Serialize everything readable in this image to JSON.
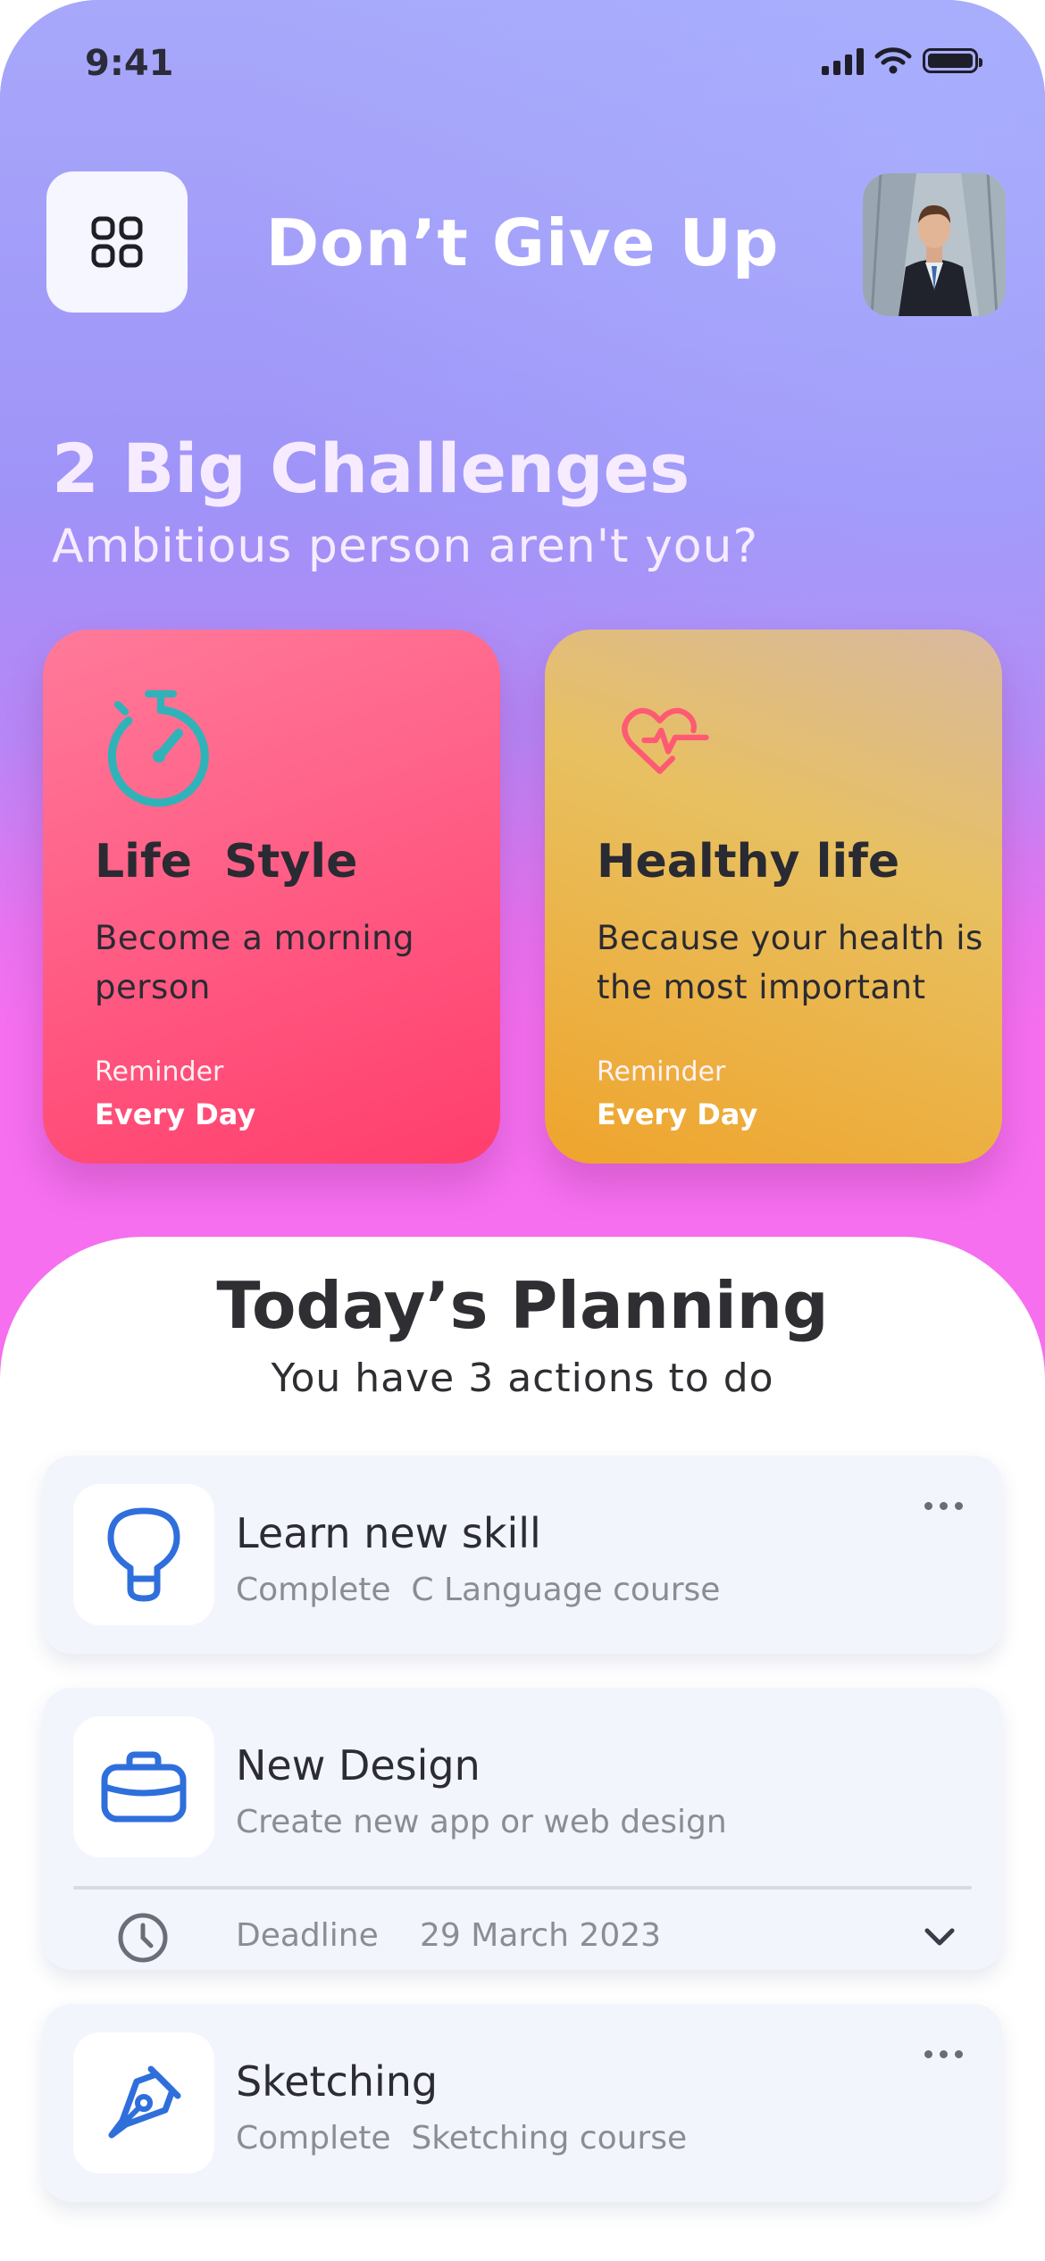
{
  "status_bar": {
    "time": "9:41"
  },
  "header": {
    "title": "Don’t Give Up",
    "menu_icon": "grid-icon",
    "avatar": "user-avatar"
  },
  "challenges": {
    "title": "2 Big Challenges",
    "subtitle": "Ambitious person aren't you?",
    "cards": [
      {
        "icon": "stopwatch-icon",
        "title": "Life  Style",
        "description": "Become a morning person",
        "reminder_label": "Reminder",
        "reminder_value": "Every Day"
      },
      {
        "icon": "heartbeat-icon",
        "title": "Healthy life",
        "description": "Because your health is the most important",
        "reminder_label": "Reminder",
        "reminder_value": "Every Day"
      }
    ]
  },
  "planning": {
    "title": "Today’s Planning",
    "subtitle": "You have 3 actions to do",
    "tasks": [
      {
        "icon": "lightbulb-icon",
        "title": "Learn new skill",
        "description": "Complete  C Language course"
      },
      {
        "icon": "briefcase-icon",
        "title": "New Design",
        "description": "Create new app or web design",
        "deadline_label": "Deadline",
        "deadline_date": "29 March 2023"
      },
      {
        "icon": "pen-nib-icon",
        "title": "Sketching",
        "description": "Complete  Sketching course"
      }
    ]
  },
  "colors": {
    "accent_blue": "#2f6fdc",
    "teal": "#2fb3b8",
    "life_card": "#ff5c84",
    "health_card": "#ebb247"
  }
}
